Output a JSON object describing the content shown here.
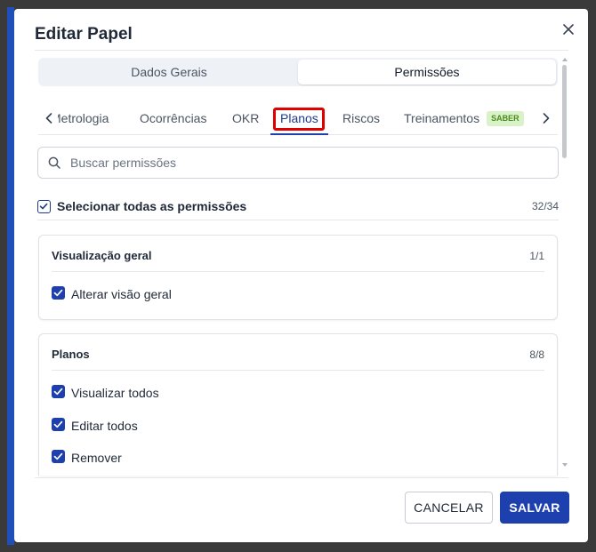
{
  "dialog": {
    "title": "Editar Papel",
    "close_icon": "close-icon"
  },
  "segmented": {
    "items": [
      "Dados Gerais",
      "Permissões"
    ],
    "selected": "Permissões"
  },
  "tabs": {
    "items": [
      {
        "label": "Metrologia"
      },
      {
        "label": "Ocorrências"
      },
      {
        "label": "OKR"
      },
      {
        "label": "Planos",
        "active": true,
        "highlighted": true
      },
      {
        "label": "Riscos"
      },
      {
        "label": "Treinamentos",
        "badge": "SABER"
      }
    ],
    "prev_icon": "chevron-left-icon",
    "next_icon": "chevron-right-icon"
  },
  "search": {
    "placeholder": "Buscar permissões",
    "value": "",
    "icon": "search-icon"
  },
  "select_all": {
    "label": "Selecionar todas as permissões",
    "count": "32/34",
    "checked": true
  },
  "sections": [
    {
      "title": "Visualização geral",
      "count": "1/1",
      "permissions": [
        {
          "label": "Alterar visão geral",
          "checked": true
        }
      ]
    },
    {
      "title": "Planos",
      "count": "8/8",
      "permissions": [
        {
          "label": "Visualizar todos",
          "checked": true
        },
        {
          "label": "Editar todos",
          "checked": true
        },
        {
          "label": "Remover",
          "checked": true
        }
      ]
    }
  ],
  "footer": {
    "cancel_label": "CANCELAR",
    "save_label": "SALVAR"
  },
  "colors": {
    "primary": "#1e40af",
    "highlight_box": "#e00000",
    "badge_bg": "#d9f2c7",
    "badge_text": "#4a8a20",
    "backdrop": "#3a3a3a"
  }
}
